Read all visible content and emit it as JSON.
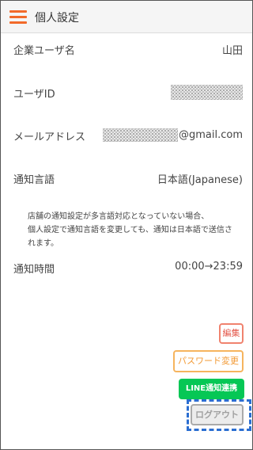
{
  "header": {
    "title": "個人設定",
    "menu_icon": "hamburger-menu-icon",
    "accent_color": "#f26a2a"
  },
  "fields": {
    "company_user_name": {
      "label": "企業ユーザ名",
      "value": "山田"
    },
    "user_id": {
      "label": "ユーザID"
    },
    "email": {
      "label": "メールアドレス",
      "domain": "@gmail.com"
    },
    "notification_language": {
      "label": "通知言語",
      "value": "日本語(Japanese)"
    },
    "notification_time": {
      "label": "通知時間",
      "value": "00:00→23:59"
    }
  },
  "note": {
    "lines": [
      "店舗の通知設定が多言語対応となっていない場合、",
      "個人設定で通知言語を変更しても、通知は日本語で送信さ",
      "れます。"
    ]
  },
  "buttons": {
    "edit": {
      "label": "編集",
      "color": "#e4574a"
    },
    "change_password": {
      "label": "パスワード変更",
      "color": "#f29a35"
    },
    "line_link": {
      "label": "LINE通知連携",
      "color": "#06c755"
    },
    "logout": {
      "label": "ログアウト",
      "color": "#a0a0a0"
    }
  },
  "highlight_color": "#2b6ed1"
}
